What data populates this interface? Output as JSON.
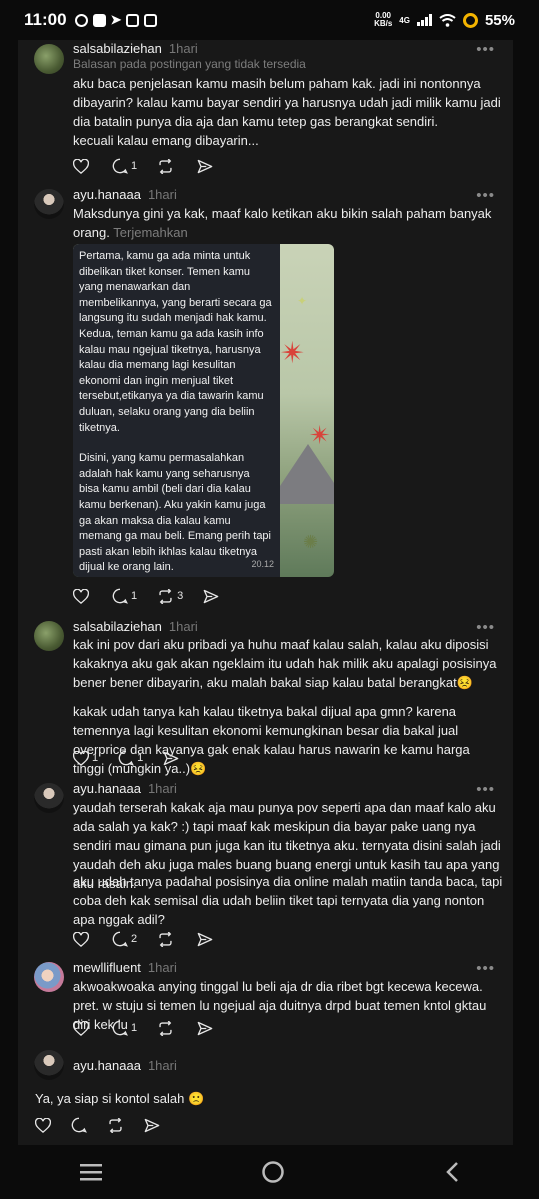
{
  "status_bar": {
    "time": "11:00",
    "speed_value": "0.00",
    "speed_unit": "KB/s",
    "network": "4G",
    "battery": "55%"
  },
  "posts": [
    {
      "username": "salsabilaziehan",
      "time_ago": "1hari",
      "reply_note": "Balasan pada postingan yang tidak tersedia",
      "paragraphs": [
        "aku baca penjelasan kamu masih belum paham kak. jadi ini nontonnya dibayarin? kalau kamu bayar sendiri ya harusnya udah jadi milik kamu jadi dia batalin punya dia aja dan kamu tetep gas berangkat sendiri.",
        "kecuali kalau emang dibayarin..."
      ],
      "likes": "",
      "replies": "1",
      "reposts": ""
    },
    {
      "username": "ayu.hanaaa",
      "time_ago": "1hari",
      "text": "Maksdunya gini ya kak, maaf kalo ketikan aku bikin salah paham banyak orang.",
      "translate_label": "Terjemahkan",
      "image_message": [
        "Pertama, kamu ga ada minta untuk dibelikan tiket konser. Temen kamu yang menawarkan dan membelikannya, yang berarti secara ga langsung itu sudah menjadi hak kamu. Kedua, teman kamu ga ada kasih info kalau mau ngejual tiketnya, harusnya kalau dia memang lagi kesulitan ekonomi dan ingin menjual tiket tersebut,etikanya ya dia tawarin kamu duluan, selaku orang yang dia beliin tiketnya.",
        "Disini, yang kamu permasalahkan adalah hak kamu yang seharusnya bisa kamu ambil (beli dari dia kalau kamu berkenan). Aku yakin kamu juga ga akan maksa dia kalau kamu memang ga mau beli. Emang perih tapi pasti akan lebih ikhlas kalau tiketnya dijual ke orang lain."
      ],
      "image_time": "20.12",
      "likes": "",
      "replies": "1",
      "reposts": "3"
    },
    {
      "username": "salsabilaziehan",
      "time_ago": "1hari",
      "paragraphs": [
        "kak ini pov dari aku pribadi ya huhu maaf kalau salah, kalau aku diposisi kakaknya aku gak akan ngeklaim itu udah hak milik aku apalagi posisinya bener bener dibayarin, aku malah bakal siap kalau batal berangkat😣",
        "kakak udah tanya kah kalau tiketnya bakal dijual apa gmn? karena temennya lagi kesulitan ekonomi kemungkinan besar dia bakal jual overprice dan kayanya gak enak kalau harus nawarin ke kamu harga tinggi (mungkin ya..)😣"
      ],
      "likes": "1",
      "replies": "1",
      "reposts": ""
    },
    {
      "username": "ayu.hanaaa",
      "time_ago": "1hari",
      "paragraphs": [
        "yaudah terserah kakak aja mau punya pov seperti apa dan maaf kalo aku ada salah ya kak? :) tapi maaf kak meskipun dia bayar pake uang nya sendiri mau gimana pun juga kan itu tiketnya aku. ternyata disini salah jadi yaudah deh aku juga males buang buang energi untuk kasih tau apa yang aku rasain.",
        "aku udah tanya padahal posisinya dia online malah matiin tanda baca, tapi coba deh kak semisal dia udah beliin tiket tapi ternyata dia yang nonton apa nggak adil?"
      ],
      "likes": "",
      "replies": "2",
      "reposts": ""
    },
    {
      "username": "mewllifluent",
      "time_ago": "1hari",
      "paragraphs": [
        "akwoakwoaka anying tinggal lu beli aja dr dia ribet bgt kecewa kecewa. pret. w stuju si temen lu ngejual aja duitnya drpd buat temen kntol gktau diri kek lu"
      ],
      "likes": "",
      "replies": "1",
      "reposts": ""
    },
    {
      "username": "ayu.hanaaa",
      "time_ago": "1hari",
      "paragraphs": [
        "Ya, ya siap si kontol salah 🙁"
      ],
      "likes": "",
      "replies": "",
      "reposts": ""
    }
  ],
  "icons": {
    "like": "heart-icon",
    "reply": "speech-bubble-icon",
    "repost": "repost-icon",
    "share": "send-icon",
    "more": "more-dots-icon",
    "nav": [
      "menu-icon",
      "home-circle-icon",
      "back-chevron-icon"
    ]
  },
  "colors": {
    "background": "#181818",
    "muted": "#777777",
    "star": "#d9423a"
  }
}
